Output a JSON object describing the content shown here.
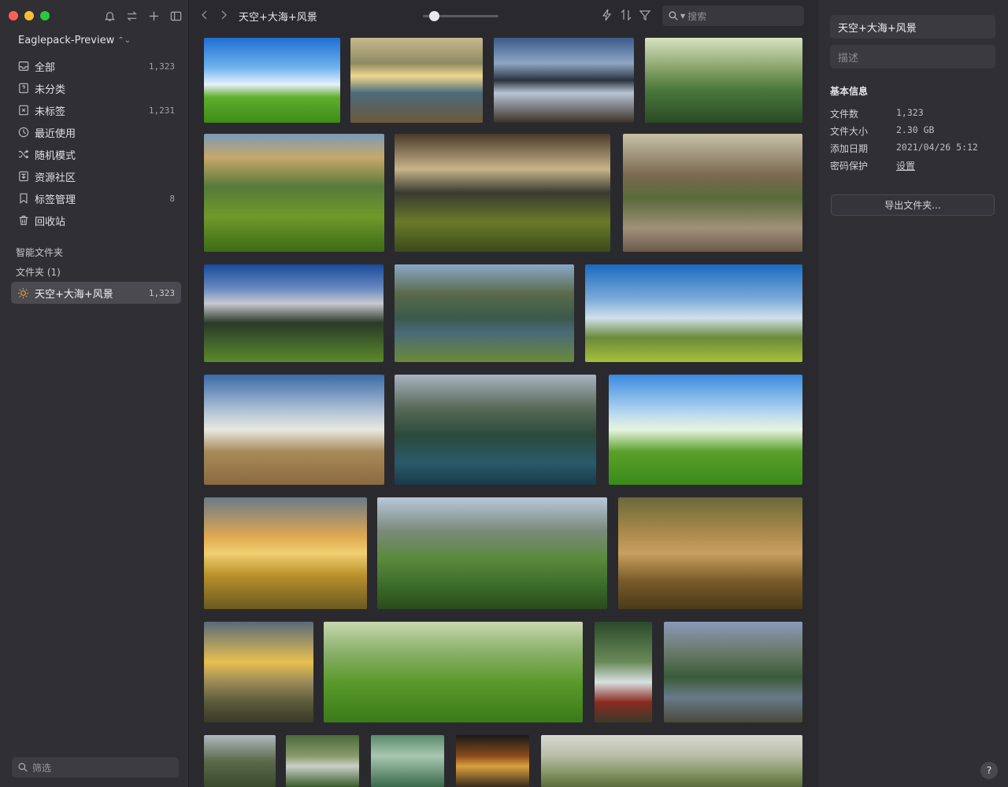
{
  "window": {
    "traffic_colors": {
      "close": "#ff5f57",
      "minimize": "#febc2e",
      "zoom": "#28c840"
    }
  },
  "sidebar": {
    "library_name": "Eaglepack-Preview",
    "items": [
      {
        "label": "全部",
        "count": "1,323",
        "icon": "inbox-icon"
      },
      {
        "label": "未分类",
        "count": "",
        "icon": "uncategorized-icon"
      },
      {
        "label": "未标签",
        "count": "1,231",
        "icon": "untagged-icon"
      },
      {
        "label": "最近使用",
        "count": "",
        "icon": "clock-icon"
      },
      {
        "label": "随机模式",
        "count": "",
        "icon": "shuffle-icon"
      },
      {
        "label": "资源社区",
        "count": "",
        "icon": "community-icon"
      },
      {
        "label": "标签管理",
        "count": "8",
        "icon": "tag-icon"
      },
      {
        "label": "回收站",
        "count": "",
        "icon": "trash-icon"
      }
    ],
    "smart_folders_label": "智能文件夹",
    "folders_label": "文件夹 (1)",
    "folder": {
      "label": "天空+大海+风景",
      "count": "1,323"
    },
    "filter_placeholder": "筛选"
  },
  "toolbar": {
    "title": "天空+大海+风景",
    "search_placeholder": "搜索",
    "zoom_level": 0.15
  },
  "inspector": {
    "name_value": "天空+大海+风景",
    "description_placeholder": "描述",
    "section_title": "基本信息",
    "info": [
      {
        "key": "文件数",
        "value": "1,323"
      },
      {
        "key": "文件大小",
        "value": "2.30 GB"
      },
      {
        "key": "添加日期",
        "value": "2021/04/26 5:12"
      }
    ],
    "password_key": "密码保护",
    "password_link": "设置",
    "export_label": "导出文件夹...",
    "help_label": "?"
  },
  "thumbnails": [
    {
      "name": "blue-sky-green-field",
      "g": "linear-gradient(180deg,#1f6fd1 0%,#6fb2ee 35%,#e6f2fb 55%,#5fae2c 70%,#3d8c17 100%)"
    },
    {
      "name": "mountain-lake-sunrise",
      "g": "linear-gradient(180deg,#c9b88e 0%,#8d8a64 30%,#f0d890 45%,#4d6a7a 65%,#6a5a3d 100%)"
    },
    {
      "name": "mountain-reflection-sunset",
      "g": "linear-gradient(180deg,#3a5a8a 0%,#8fa6c4 30%,#2b3240 50%,#b9c4d4 65%,#3b3128 100%)"
    },
    {
      "name": "green-ridge-mist",
      "g": "linear-gradient(180deg,#d7e3c0 0%,#8aa56c 35%,#4b7a3c 60%,#2a4a25 100%)"
    },
    {
      "name": "terraced-hills",
      "g": "linear-gradient(180deg,#7a9ab8 0%,#c8a86a 20%,#557a3a 45%,#6f9a2a 70%,#3d6a18 100%)"
    },
    {
      "name": "dramatic-valley-clouds",
      "g": "linear-gradient(180deg,#4a3a2a 0%,#c8b48a 30%,#3a3a30 50%,#6a7a2a 75%,#3a4a1a 100%)"
    },
    {
      "name": "canyon-rocks",
      "g": "linear-gradient(180deg,#c8c0a8 0%,#7a6a50 35%,#5a6a3a 55%,#a0907a 80%,#6a5a4a 100%)"
    },
    {
      "name": "alps-village",
      "g": "linear-gradient(180deg,#1a4a9a 0%,#6a8ac0 25%,#c8c8d0 40%,#2a3a2a 60%,#5a8a2a 100%)"
    },
    {
      "name": "lake-hills",
      "g": "linear-gradient(180deg,#8aa8c8 0%,#5a6a4a 30%,#3a5a4a 55%,#4a6a78 70%,#6a8a3a 100%)"
    },
    {
      "name": "prairie-tree",
      "g": "linear-gradient(180deg,#1a6ac0 0%,#7aaad8 35%,#d0e0ea 55%,#6a8a3a 75%,#a8c03a 100%)"
    },
    {
      "name": "haystacks-field",
      "g": "linear-gradient(180deg,#3a6aa8 0%,#b8c8d8 35%,#e8e8e0 50%,#a88a5a 70%,#8a6a40 100%)"
    },
    {
      "name": "fjord-waterfall",
      "g": "linear-gradient(180deg,#a8b4c0 0%,#5a6a5a 30%,#2a4a3a 55%,#2a5a6a 80%,#1a3a4a 100%)"
    },
    {
      "name": "sunny-meadow",
      "g": "linear-gradient(180deg,#3a8ae0 0%,#b8d8f0 35%,#e8f4e0 50%,#5aa02a 70%,#3a8a1a 100%)"
    },
    {
      "name": "golden-sunset-field",
      "g": "linear-gradient(180deg,#6a7a8a 0%,#e0a850 35%,#f0d070 50%,#b8902a 70%,#6a5a20 100%)"
    },
    {
      "name": "fantasy-valley",
      "g": "linear-gradient(180deg,#b8c8d8 0%,#7a8a7a 30%,#5a8a3a 55%,#3a6a2a 80%,#2a4a1a 100%)"
    },
    {
      "name": "enchanted-forest",
      "g": "linear-gradient(180deg,#6a6a3a 0%,#a8884a 30%,#c8a060 50%,#7a5a2a 75%,#4a3a1a 100%)"
    },
    {
      "name": "fantasy-sunrise",
      "g": "linear-gradient(180deg,#5a6a7a 0%,#e8c050 40%,#9a8a5a 60%,#5a5a3a 80%,#3a3a2a 100%)"
    },
    {
      "name": "tea-leaves",
      "g": "linear-gradient(180deg,#c8d8b0 0%,#8ab06a 30%,#5a9a2a 60%,#3a7a1a 100%)"
    },
    {
      "name": "forest-waterfall",
      "g": "linear-gradient(180deg,#2a4a2a 0%,#6a8a5a 40%,#d8e0e0 60%,#8a2a20 80%,#3a3a2a 100%)"
    },
    {
      "name": "yosemite-lake",
      "g": "linear-gradient(180deg,#8a9ab8 0%,#6a7a6a 30%,#3a5a3a 55%,#6a7a8a 75%,#4a4a3a 100%)"
    },
    {
      "name": "waterfall-cliff",
      "g": "linear-gradient(180deg,#b0b8c0 0%,#5a6a4a 50%,#3a4a2a 100%)"
    },
    {
      "name": "stream-forest",
      "g": "linear-gradient(180deg,#4a6a3a 0%,#8a9a6a 40%,#c8d0c8 60%,#3a5a2a 100%)"
    },
    {
      "name": "misty-falls",
      "g": "linear-gradient(180deg,#5a8a6a 0%,#a8c8b0 40%,#3a6a4a 100%)"
    },
    {
      "name": "autumn-falls",
      "g": "linear-gradient(180deg,#1a1a1a 0%,#8a4a1a 40%,#d8a040 60%,#3a2a1a 100%)"
    },
    {
      "name": "hazy-meadow",
      "g": "linear-gradient(180deg,#d8d8d0 0%,#b8bca8 40%,#8a9a6a 70%,#5a6a3a 100%)"
    }
  ]
}
